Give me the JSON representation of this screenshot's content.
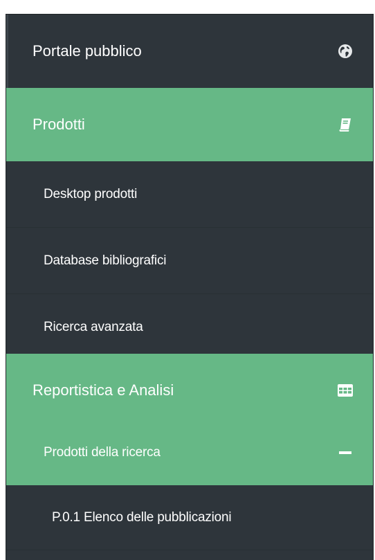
{
  "sidebar": {
    "items": [
      {
        "label": "Portale pubblico",
        "icon": "globe-icon",
        "level": 0,
        "state": "collapsed"
      },
      {
        "label": "Prodotti",
        "icon": "book-icon",
        "level": 0,
        "state": "expanded"
      },
      {
        "label": "Desktop prodotti",
        "level": 1
      },
      {
        "label": "Database bibliografici",
        "level": 1
      },
      {
        "label": "Ricerca avanzata",
        "level": 1
      },
      {
        "label": "Reportistica e Analisi",
        "icon": "table-icon",
        "level": 0,
        "state": "expanded"
      },
      {
        "label": "Prodotti della ricerca",
        "icon": "minus-icon",
        "level": 1,
        "state": "expanded"
      },
      {
        "label": "P.0.1 Elenco delle pubblicazioni",
        "level": 2
      }
    ]
  },
  "colors": {
    "sidebar_bg": "#2e353b",
    "active_green": "#66b886",
    "text": "#ffffff"
  }
}
